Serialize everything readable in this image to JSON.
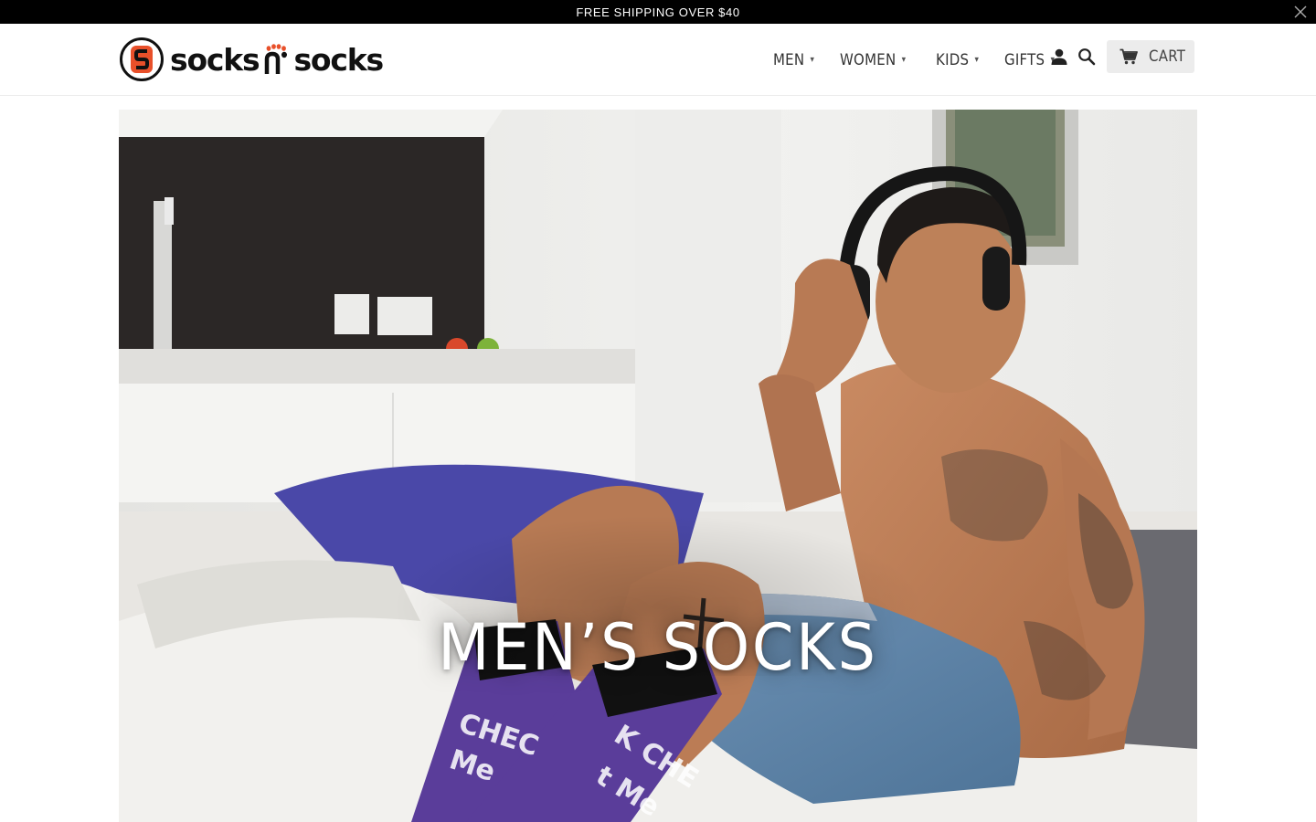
{
  "announcement": {
    "text": "FREE SHIPPING OVER $40",
    "close_icon": "close-icon"
  },
  "header": {
    "logo": {
      "word_left": "socks",
      "word_right": "socks",
      "icon": "socks-logo-icon"
    },
    "nav": [
      {
        "label": "MEN",
        "caret": "▾"
      },
      {
        "label": "WOMEN",
        "caret": "▾"
      },
      {
        "label": "KIDS",
        "caret": "▾"
      },
      {
        "label": "GIFTS",
        "caret": "▾"
      }
    ],
    "account_icon": "user-icon",
    "search_icon": "search-icon",
    "cart": {
      "label": "CART",
      "icon": "cart-icon"
    }
  },
  "hero": {
    "title": "MEN’S SOCKS",
    "sock_text": "CHECK ME OUT"
  },
  "colors": {
    "announcement_bg": "#000000",
    "cart_bg": "#ececec",
    "brand_orange": "#e8502a",
    "sock_purple": "#5a3d9a"
  }
}
